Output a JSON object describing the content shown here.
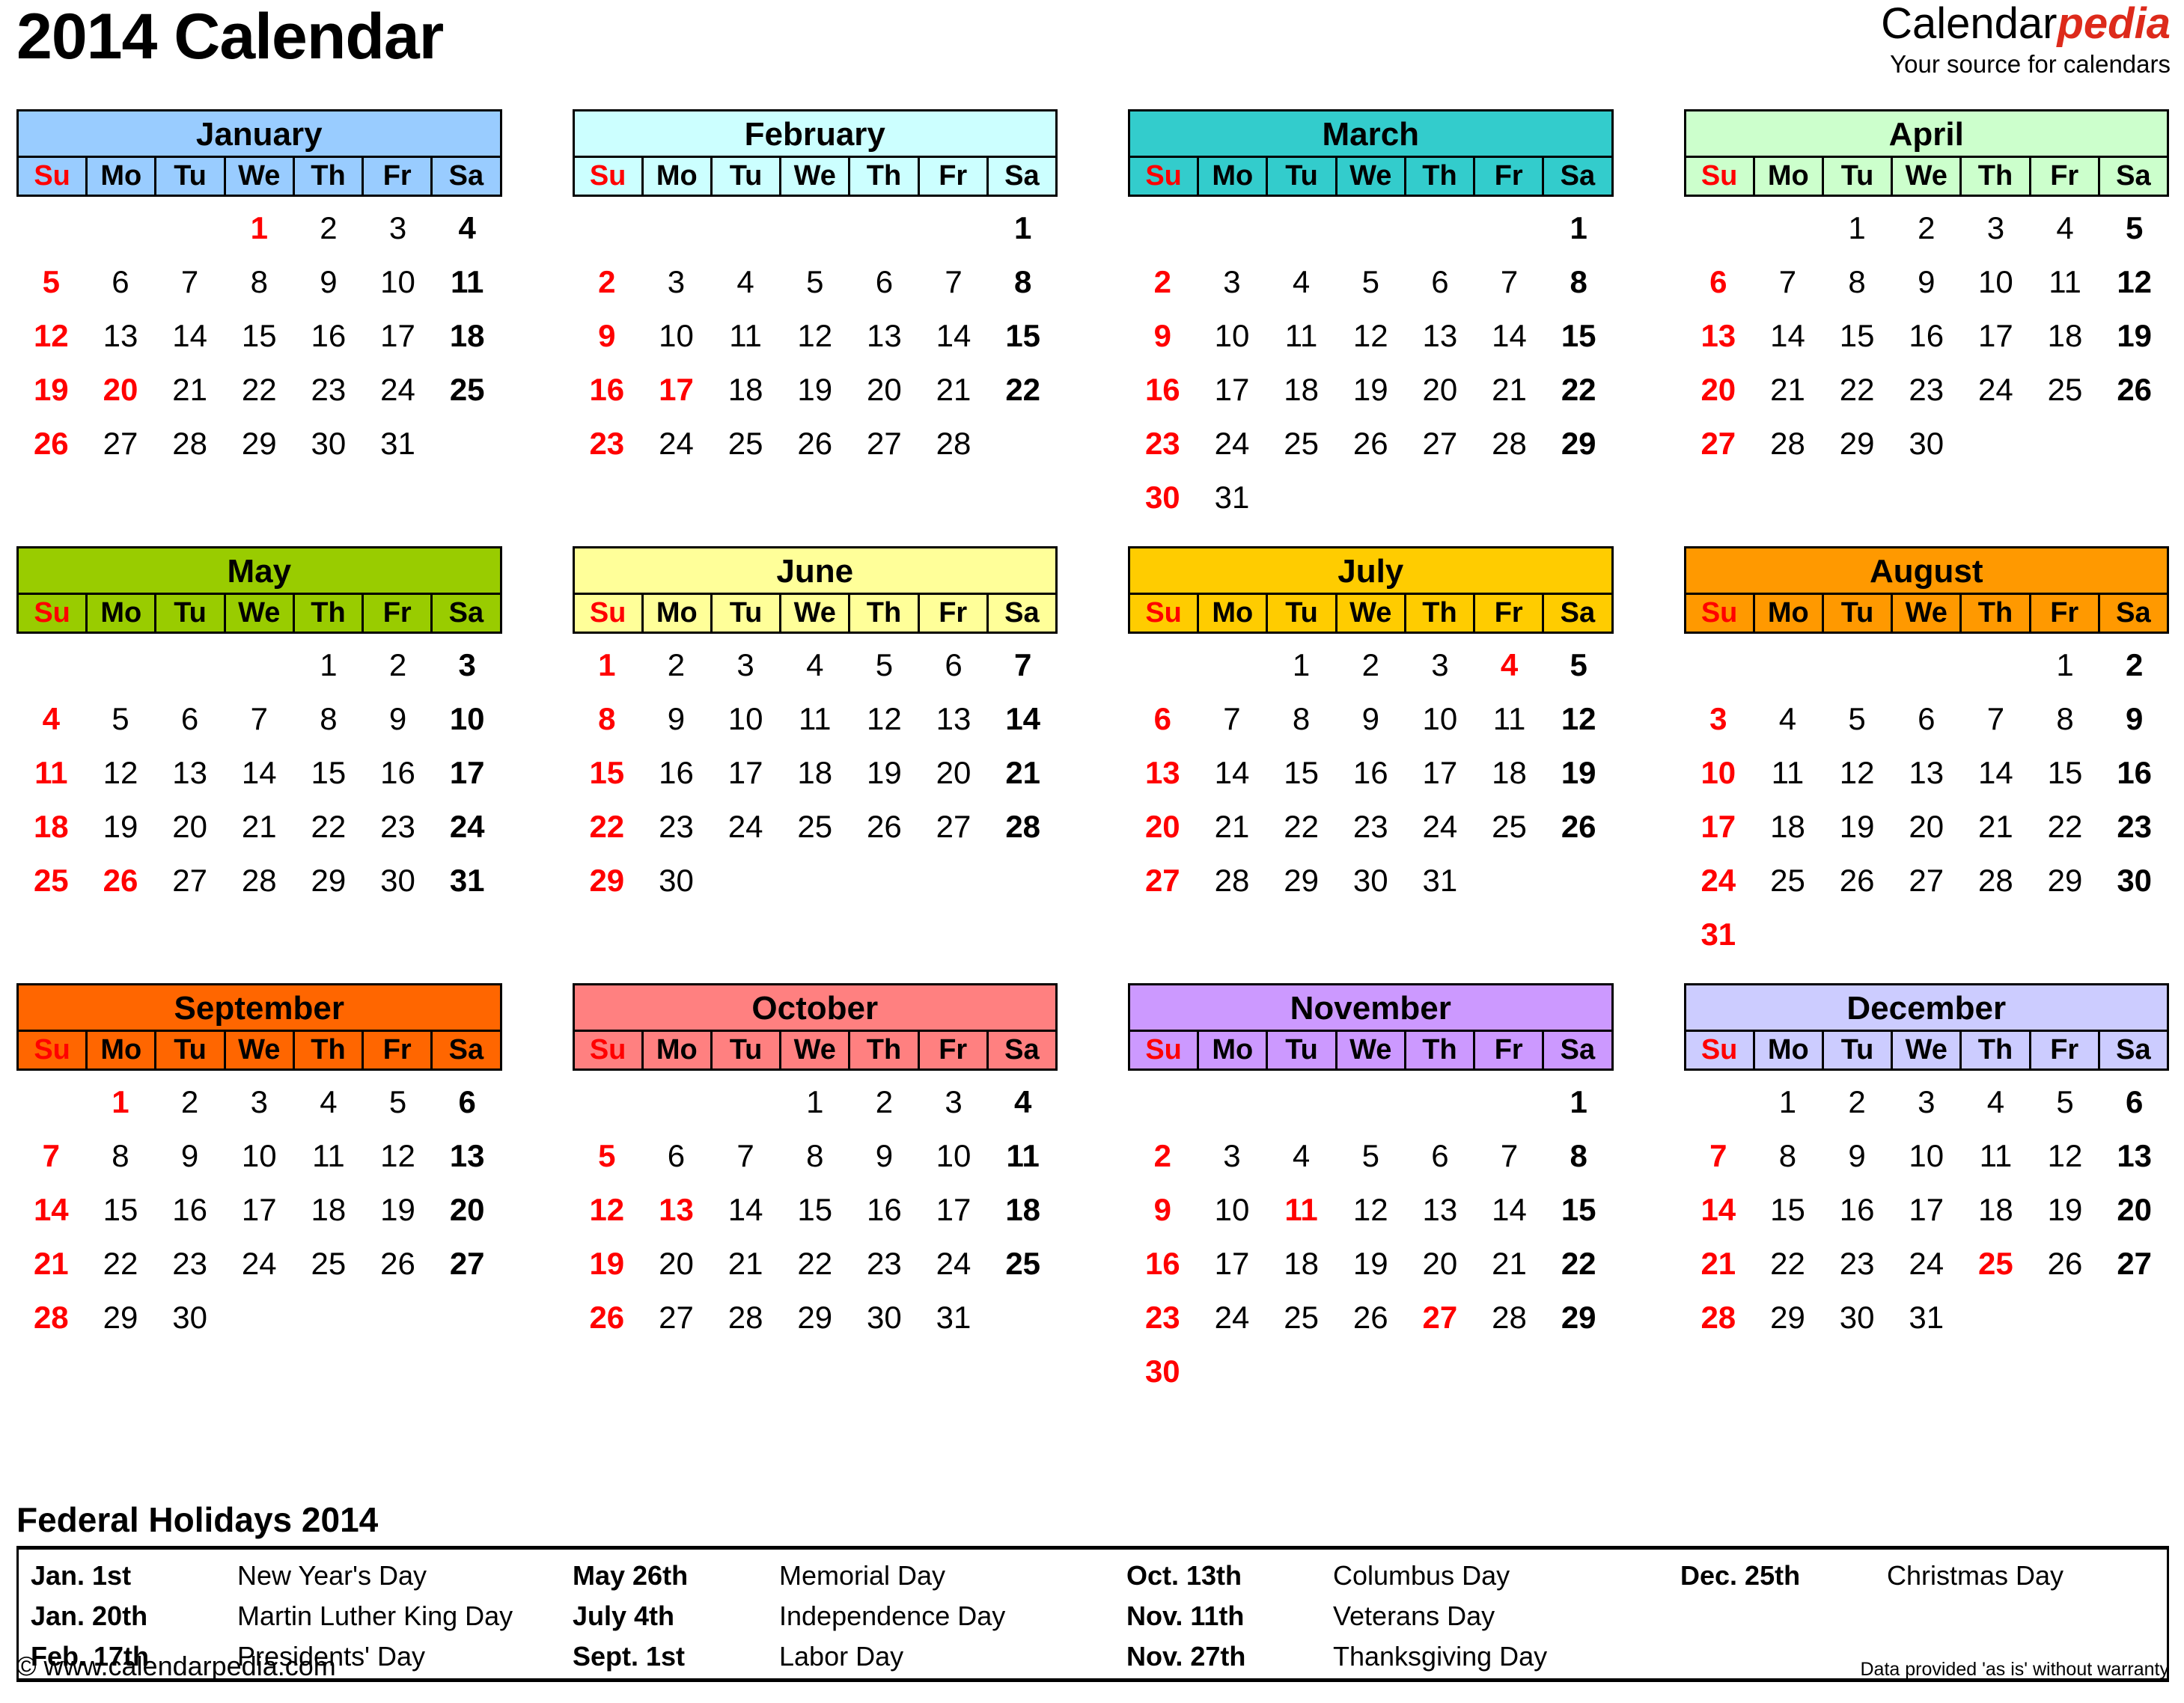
{
  "header": {
    "title": "2014 Calendar",
    "brand_part1": "Calendar",
    "brand_part2": "pedia",
    "tagline": "Your source for calendars",
    "brand_accent_color": "#dd2a1b"
  },
  "weekday_headers": [
    "Su",
    "Mo",
    "Tu",
    "We",
    "Th",
    "Fr",
    "Sa"
  ],
  "colors": {
    "sunday_text": "#ff0000",
    "holiday_text": "#ff0000",
    "saturday_text": "#000000",
    "weekday_text": "#000000",
    "border": "#000000"
  },
  "months": [
    {
      "name": "January",
      "color": "#99ccff",
      "lead_blanks": 3,
      "num_days": 31,
      "holidays": [
        1,
        20
      ]
    },
    {
      "name": "February",
      "color": "#ccffff",
      "lead_blanks": 6,
      "num_days": 28,
      "holidays": [
        17
      ]
    },
    {
      "name": "March",
      "color": "#33cccc",
      "lead_blanks": 6,
      "num_days": 31,
      "holidays": []
    },
    {
      "name": "April",
      "color": "#ccffcc",
      "lead_blanks": 2,
      "num_days": 30,
      "holidays": []
    },
    {
      "name": "May",
      "color": "#99cc00",
      "lead_blanks": 4,
      "num_days": 31,
      "holidays": [
        26
      ]
    },
    {
      "name": "June",
      "color": "#ffff99",
      "lead_blanks": 0,
      "num_days": 30,
      "holidays": []
    },
    {
      "name": "July",
      "color": "#ffcc00",
      "lead_blanks": 2,
      "num_days": 31,
      "holidays": [
        4
      ]
    },
    {
      "name": "August",
      "color": "#ff9900",
      "lead_blanks": 5,
      "num_days": 31,
      "holidays": []
    },
    {
      "name": "September",
      "color": "#ff6600",
      "lead_blanks": 1,
      "num_days": 30,
      "holidays": [
        1
      ]
    },
    {
      "name": "October",
      "color": "#ff8080",
      "lead_blanks": 3,
      "num_days": 31,
      "holidays": [
        13
      ]
    },
    {
      "name": "November",
      "color": "#cc99ff",
      "lead_blanks": 6,
      "num_days": 30,
      "holidays": [
        11,
        27
      ]
    },
    {
      "name": "December",
      "color": "#ccccff",
      "lead_blanks": 1,
      "num_days": 31,
      "holidays": [
        25
      ]
    }
  ],
  "holidays_section": {
    "title": "Federal Holidays 2014",
    "rows": [
      [
        {
          "date": "Jan. 1st",
          "name": "New Year's Day"
        },
        {
          "date": "May 26th",
          "name": "Memorial Day"
        },
        {
          "date": "Oct. 13th",
          "name": "Columbus Day"
        },
        {
          "date": "Dec. 25th",
          "name": "Christmas Day"
        }
      ],
      [
        {
          "date": "Jan. 20th",
          "name": "Martin Luther King Day"
        },
        {
          "date": "July 4th",
          "name": "Independence Day"
        },
        {
          "date": "Nov. 11th",
          "name": "Veterans Day"
        },
        {
          "date": "",
          "name": ""
        }
      ],
      [
        {
          "date": "Feb. 17th",
          "name": "Presidents' Day"
        },
        {
          "date": "Sept. 1st",
          "name": "Labor Day"
        },
        {
          "date": "Nov. 27th",
          "name": "Thanksgiving Day"
        },
        {
          "date": "",
          "name": ""
        }
      ]
    ]
  },
  "footer": {
    "copyright": "© www.calendarpedia.com",
    "disclaimer": "Data provided 'as is' without warranty"
  }
}
